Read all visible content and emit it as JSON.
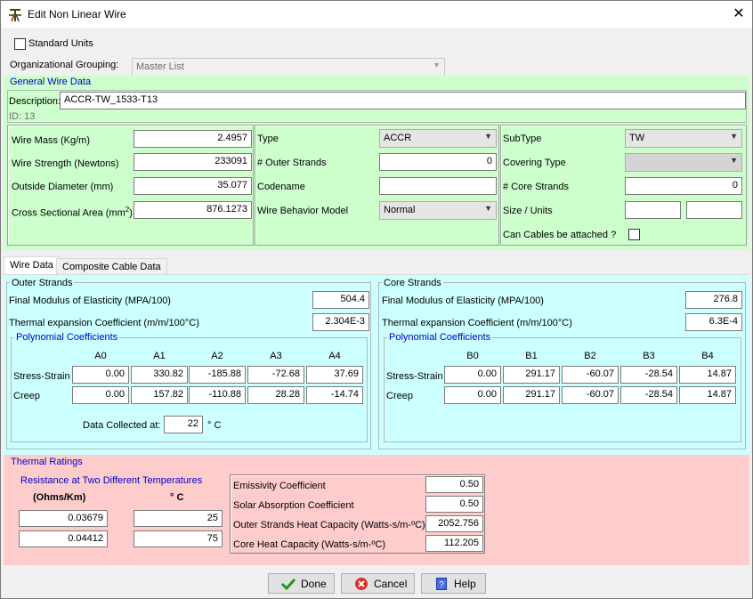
{
  "window": {
    "title": "Edit Non Linear Wire",
    "close_glyph": "✕"
  },
  "standard_units": {
    "label": "Standard Units",
    "checked": false
  },
  "org_grouping": {
    "label": "Organizational Grouping:",
    "value": "Master List"
  },
  "general": {
    "title": "General Wire Data",
    "description_label": "Description:",
    "description_value": "ACCR-TW_1533-T13",
    "id_text": "ID: 13",
    "wire_mass_label": "Wire Mass (Kg/m)",
    "wire_mass": "2.4957",
    "wire_strength_label": "Wire Strength (Newtons)",
    "wire_strength": "233091",
    "outside_diameter_label": "Outside Diameter (mm)",
    "outside_diameter": "35.077",
    "cross_area_label": "Cross Sectional Area (mm",
    "cross_area_sup": "2",
    "cross_area_close": ")",
    "cross_area": "876.1273",
    "type_label": "Type",
    "type_value": "ACCR",
    "outer_strands_label": "# Outer Strands",
    "outer_strands": "0",
    "codename_label": "Codename",
    "codename": "",
    "behavior_label": "Wire Behavior Model",
    "behavior_value": "Normal",
    "subtype_label": "SubType",
    "subtype_value": "TW",
    "covering_label": "Covering Type",
    "covering_value": "",
    "core_strands_label": "# Core Strands",
    "core_strands": "0",
    "size_units_label": "Size / Units",
    "size_value": "",
    "units_value": "",
    "cables_label": "Can Cables be attached ?"
  },
  "tabs": [
    {
      "label": "Wire Data"
    },
    {
      "label": "Composite Cable Data"
    }
  ],
  "outer": {
    "title": "Outer Strands",
    "modulus_label": "Final Modulus of Elasticity (MPA/100)",
    "modulus": "504.4",
    "thermal_label": "Thermal expansion Coefficient (m/m/100°C)",
    "thermal": "2.304E-3",
    "poly_title": "Polynomial Coefficients",
    "headers": [
      "A0",
      "A1",
      "A2",
      "A3",
      "A4"
    ],
    "rows": [
      {
        "label": "Stress-Strain",
        "values": [
          "0.00",
          "330.82",
          "-185.88",
          "-72.68",
          "37.69"
        ]
      },
      {
        "label": "Creep",
        "values": [
          "0.00",
          "157.82",
          "-110.88",
          "28.28",
          "-14.74"
        ]
      }
    ],
    "collected_label": "Data Collected at:",
    "collected_value": "22",
    "collected_unit": "° C"
  },
  "core": {
    "title": "Core Strands",
    "modulus_label": "Final Modulus of Elasticity (MPA/100)",
    "modulus": "276.8",
    "thermal_label": "Thermal expansion Coefficient (m/m/100°C)",
    "thermal": "6.3E-4",
    "poly_title": "Polynomial Coefficients",
    "headers": [
      "B0",
      "B1",
      "B2",
      "B3",
      "B4"
    ],
    "rows": [
      {
        "label": "Stress-Strain",
        "values": [
          "0.00",
          "291.17",
          "-60.07",
          "-28.54",
          "14.87"
        ]
      },
      {
        "label": "Creep",
        "values": [
          "0.00",
          "291.17",
          "-60.07",
          "-28.54",
          "14.87"
        ]
      }
    ]
  },
  "thermal": {
    "title": "Thermal Ratings",
    "resistance_title": "Resistance at Two Different Temperatures",
    "ohms_header": "(Ohms/Km)",
    "temp_header": "° C",
    "rows": [
      {
        "ohms": "0.03679",
        "temp": "25"
      },
      {
        "ohms": "0.04412",
        "temp": "75"
      }
    ],
    "emissivity_label": "Emissivity Coefficient",
    "emissivity": "0.50",
    "solar_label": "Solar Absorption Coefficient",
    "solar": "0.50",
    "outer_heat_label": "Outer Strands Heat Capacity (Watts-s/m-ºC)",
    "outer_heat": "2052.756",
    "core_heat_label": "Core Heat Capacity (Watts-s/m-ºC)",
    "core_heat": "112.205"
  },
  "buttons": {
    "done": "Done",
    "cancel": "Cancel",
    "help": "Help"
  },
  "colors": {
    "general_bg": "#ccffcc",
    "wire_bg": "#ccffff",
    "thermal_bg": "#ffcccc",
    "group_title": "#0000cc"
  }
}
